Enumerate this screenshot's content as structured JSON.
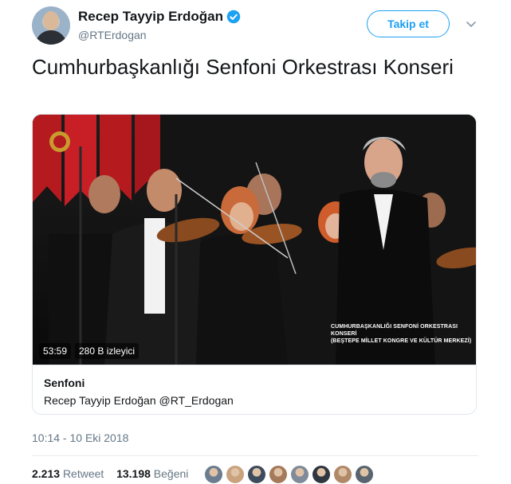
{
  "author": {
    "name": "Recep Tayyip Erdoğan",
    "handle": "@RTErdogan",
    "verified": true
  },
  "follow_button": "Takip et",
  "tweet_text": "Cumhurbaşkanlığı Senfoni Orkestrası Konseri",
  "video": {
    "duration": "53:59",
    "views": "280 B izleyici",
    "overlay_line1": "CUMHURBAŞKANLIĞI SENFONİ ORKESTRASI KONSERİ",
    "overlay_line2": "(BEŞTEPE MİLLET KONGRE VE KÜLTÜR MERKEZİ)"
  },
  "card": {
    "title": "Senfoni",
    "subtitle": "Recep Tayyip Erdoğan @RT_Erdogan"
  },
  "timestamp": "10:14 - 10 Eki 2018",
  "stats": {
    "retweets": "2.213",
    "retweet_label": "Retweet",
    "likes": "13.198",
    "like_label": "Beğeni"
  },
  "likers": [
    "#6b7d8f",
    "#c9a27e",
    "#3d4b5c",
    "#a47a5a",
    "#7f8b99",
    "#2f3640",
    "#b08968",
    "#58646f"
  ],
  "colors": {
    "accent": "#1da1f2",
    "text": "#14171a",
    "secondary": "#657786"
  }
}
